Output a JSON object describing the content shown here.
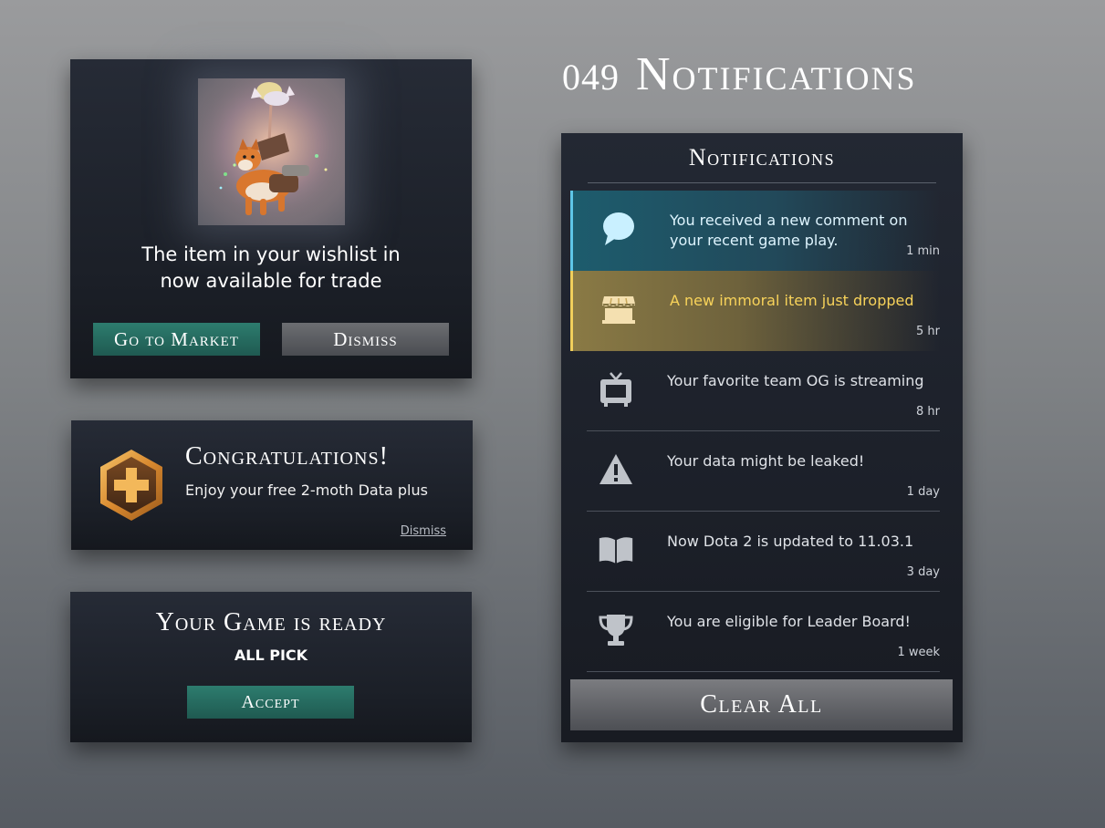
{
  "page": {
    "number": "049",
    "title": "Notifications"
  },
  "wishlist_card": {
    "message": "The item in your wishlist in now available for trade",
    "market_label": "Go to Market",
    "dismiss_label": "Dismiss"
  },
  "congrats_card": {
    "title": "Congratulations!",
    "subtitle": "Enjoy your free 2-moth Data plus",
    "dismiss_label": "Dismiss"
  },
  "ready_card": {
    "title": "Your Game is ready",
    "mode": "ALL PICK",
    "accept_label": "Accept"
  },
  "panel": {
    "title": "Notifications",
    "clear_label": "Clear All",
    "items": [
      {
        "icon": "chat-bubble-icon",
        "message": "You received a new comment on your recent game play.",
        "time": "1 min",
        "state": "active-comment"
      },
      {
        "icon": "shop-icon",
        "message": "A new immoral item just dropped",
        "time": "5 hr",
        "state": "active-item"
      },
      {
        "icon": "tv-icon",
        "message": "Your favorite team OG is streaming",
        "time": "8 hr",
        "state": "normal"
      },
      {
        "icon": "warning-icon",
        "message": "Your data might be leaked!",
        "time": "1 day",
        "state": "normal"
      },
      {
        "icon": "book-icon",
        "message": "Now Dota 2 is updated to 11.03.1",
        "time": "3 day",
        "state": "normal"
      },
      {
        "icon": "trophy-icon",
        "message": "You are eligible for  Leader Board!",
        "time": "1 week",
        "state": "normal"
      }
    ]
  },
  "colors": {
    "accent_teal": "#2d7c6e",
    "comment_highlight": "#5ec6e8",
    "item_highlight": "#f1cf5b",
    "badge_gold": "#e0a24a"
  }
}
